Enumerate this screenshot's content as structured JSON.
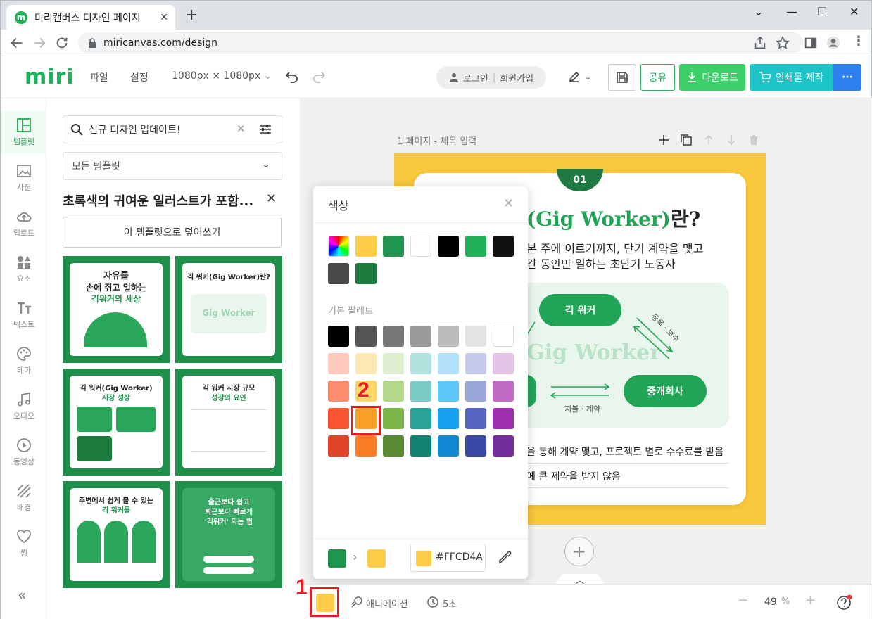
{
  "browser": {
    "tab_title": "미리캔버스 디자인 페이지",
    "url": "miricanvas.com/design"
  },
  "header": {
    "logo": "miri",
    "menu_file": "파일",
    "menu_settings": "설정",
    "canvas_size": "1080px × 1080px",
    "login": "로그인",
    "signup": "회원가입",
    "share": "공유",
    "download": "다운로드",
    "print": "인쇄물 제작",
    "more": "···"
  },
  "sidebar": {
    "items": [
      "템플릿",
      "사진",
      "업로드",
      "요소",
      "텍스트",
      "테마",
      "오디오",
      "동영상",
      "배경",
      "찜"
    ],
    "collapse": "«"
  },
  "panel": {
    "search_value": "신규 디자인 업데이트!",
    "filter": "모든 템플릿",
    "title": "초록색의 귀여운 일러스트가 포함...",
    "overwrite": "이 템플릿으로 덮어쓰기",
    "thumbs": [
      {
        "line1": "자유를",
        "line2": "손에 쥐고 일하는",
        "line3": "긱워커의 세상"
      },
      {
        "line1": "긱 워커(Gig Worker)란?",
        "line2": "Gig Worker",
        "line3": ""
      },
      {
        "line1": "긱 워커(Gig Worker)",
        "line2": "시장 성장",
        "line3": ""
      },
      {
        "line1": "긱 워커 시장 규모",
        "line2": "성장의 요인",
        "line3": ""
      },
      {
        "line1": "주변에서 쉽게 볼 수 있는",
        "line2": "긱 워커들",
        "line3": ""
      },
      {
        "line1": "출근보다 쉽고",
        "line2": "퇴근보다 빠르게",
        "line3": "'긱워커' 되는 법"
      }
    ]
  },
  "canvas": {
    "page_label": "1 페이지 - 제목 입력",
    "number": "01",
    "heading_main": "(Gig Worker)",
    "heading_tail": "란?",
    "sub1": "본 주에 이르기까지, 단기 계약을 맺고",
    "sub2": "간 동안만 일하는 초단기 노동자",
    "pill_gig": "긱 워커",
    "pill_agency": "중개회사",
    "watermark": "Gig Worker",
    "label_register": "등록 · 보수",
    "label_pay": "지불 · 계약",
    "bullet1": "을 통해 계약 맺고, 프로젝트 별로 수수료를 받음",
    "bullet2": "에 큰 제약을 받지 않음"
  },
  "color_popup": {
    "title": "색상",
    "palette_label": "기본 팔레트",
    "doc_colors": [
      "#ffcd4a",
      "#1f9550",
      "#ffffff",
      "#000000",
      "#22b058",
      "#111111",
      "#4a4a4a",
      "#1b7a3e"
    ],
    "palette": [
      [
        "#000000",
        "#555555",
        "#777777",
        "#999999",
        "#bbbbbb",
        "#e4e4e4",
        "#ffffff"
      ],
      [
        "#fdc9bf",
        "#fde9b3",
        "#dfeecf",
        "#b2e3df",
        "#b3e1fb",
        "#c6cbeb",
        "#e3c3e6"
      ],
      [
        "#fb8c6e",
        "#ffd468",
        "#b3d88a",
        "#7ccac4",
        "#5bc7f7",
        "#9aa5d8",
        "#c06cc6"
      ],
      [
        "#fc5533",
        "#f9a126",
        "#7ab649",
        "#29a399",
        "#18a1ee",
        "#5865be",
        "#9b2fae"
      ],
      [
        "#de4627",
        "#fc7b25",
        "#5a8a34",
        "#128373",
        "#1389d5",
        "#3b48a6",
        "#732e9b"
      ]
    ],
    "current_color": "#1f9550",
    "new_color": "#ffcd4a",
    "hex": "#FFCD4A"
  },
  "bottom": {
    "animation": "애니메이션",
    "duration": "5초",
    "zoom": "49",
    "zoom_unit": "%",
    "current_color": "#ffcd4a"
  },
  "annotations": {
    "step1": "1",
    "step2": "2"
  }
}
